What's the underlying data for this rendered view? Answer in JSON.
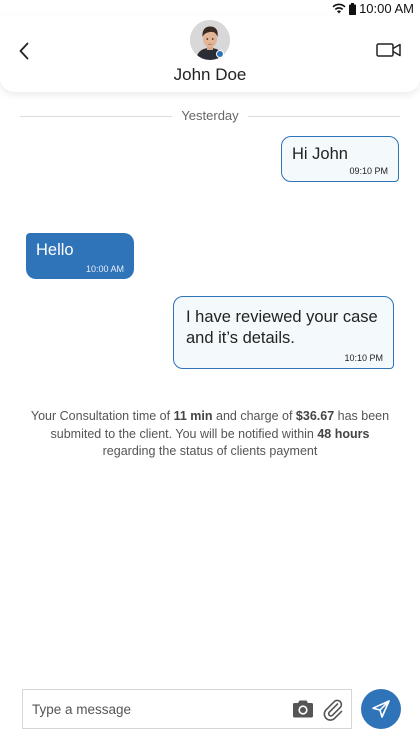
{
  "status_bar": {
    "time": "10:00 AM"
  },
  "header": {
    "contact_name": "John Doe"
  },
  "date_separator": "Yesterday",
  "messages": [
    {
      "direction": "outgoing",
      "text": "Hi John",
      "time": "09:10 PM"
    },
    {
      "direction": "incoming",
      "text": "Hello",
      "time": "10:00 AM"
    },
    {
      "direction": "outgoing",
      "text": "I have reviewed your case and it’s details.",
      "time": "10:10 PM"
    }
  ],
  "notice": {
    "part1": "Your Consultation time of ",
    "duration": "11 min",
    "part2": " and charge of ",
    "amount": "$36.67",
    "part3": " has been submited to the client. You will be notified within ",
    "window": "48 hours",
    "part4": " regarding the status of clients payment"
  },
  "composer": {
    "placeholder": "Type a message"
  },
  "colors": {
    "accent": "#2f73b8",
    "outgoing_bubble_bg": "#f4f9fc",
    "divider": "#dcdcdc"
  }
}
